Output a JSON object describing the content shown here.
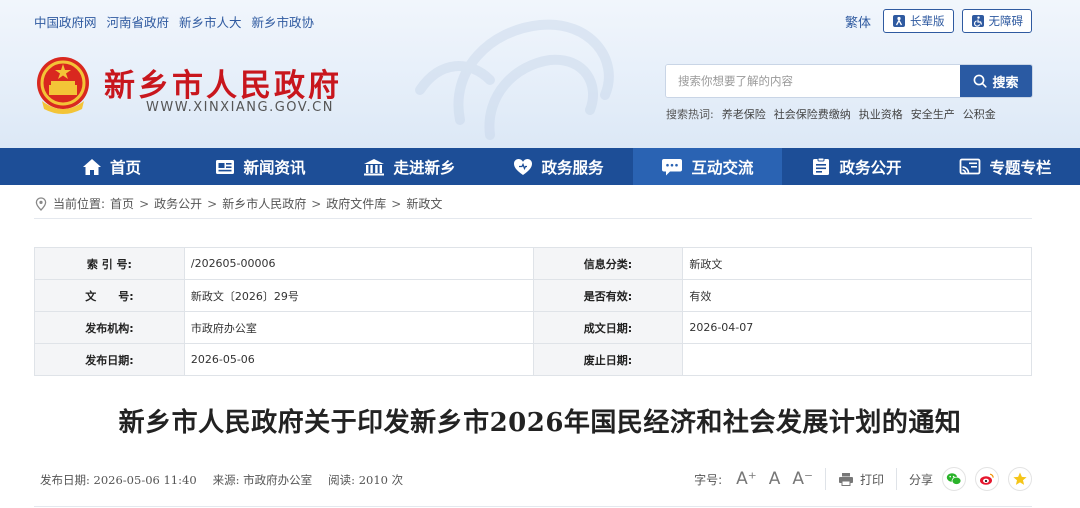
{
  "top_links": [
    "中国政府网",
    "河南省政府",
    "新乡市人大",
    "新乡市政协"
  ],
  "top_right": {
    "traditional": "繁体",
    "elder_label": "长辈版",
    "accessible_label": "无障碍"
  },
  "site": {
    "name": "新乡市人民政府",
    "url": "WWW.XINXIANG.GOV.CN",
    "emblem_icon": "national-emblem"
  },
  "search": {
    "placeholder": "搜索你想要了解的内容",
    "button_label": "搜索",
    "hot_label": "搜索热词:",
    "hot_words": [
      "养老保险",
      "社会保险费缴纳",
      "执业资格",
      "安全生产",
      "公积金"
    ]
  },
  "nav": [
    {
      "label": "首页",
      "icon": "home-icon"
    },
    {
      "label": "新闻资讯",
      "icon": "news-icon"
    },
    {
      "label": "走进新乡",
      "icon": "building-icon"
    },
    {
      "label": "政务服务",
      "icon": "heart-icon"
    },
    {
      "label": "互动交流",
      "icon": "chat-icon"
    },
    {
      "label": "政务公开",
      "icon": "document-icon"
    },
    {
      "label": "专题专栏",
      "icon": "cast-icon"
    }
  ],
  "active_nav": "互动交流",
  "breadcrumb": {
    "prefix": "当前位置:",
    "items": [
      "首页",
      "政务公开",
      "新乡市人民政府",
      "政府文件库",
      "新政文"
    ],
    "separator": ">"
  },
  "meta": {
    "rows": [
      {
        "k1": "索 引 号:",
        "v1": "/202605-00006",
        "k2": "信息分类:",
        "v2": "新政文"
      },
      {
        "k1": "文　　号:",
        "v1": "新政文〔2026〕29号",
        "k2": "是否有效:",
        "v2": "有效"
      },
      {
        "k1": "发布机构:",
        "v1": "市政府办公室",
        "k2": "成文日期:",
        "v2": "2026-04-07"
      },
      {
        "k1": "发布日期:",
        "v1": "2026-05-06",
        "k2": "废止日期:",
        "v2": ""
      }
    ]
  },
  "article": {
    "title": "新乡市人民政府关于印发新乡市2026年国民经济和社会发展计划的通知",
    "publish_label": "发布日期:",
    "publish_date": "2026-05-06 11:40",
    "source_label": "来源:",
    "source": "市政府办公室",
    "reads_label": "阅读:",
    "reads": "2010 次"
  },
  "tools": {
    "font_label": "字号:",
    "font_larger": "A⁺",
    "font_normal": "A",
    "font_smaller": "A⁻",
    "print_label": "打印",
    "share_label": "分享"
  },
  "colors": {
    "nav_bg": "#1d4e97",
    "nav_active": "#2a63b3",
    "brand_red": "#c8161d",
    "link_blue": "#2f5aa0"
  }
}
